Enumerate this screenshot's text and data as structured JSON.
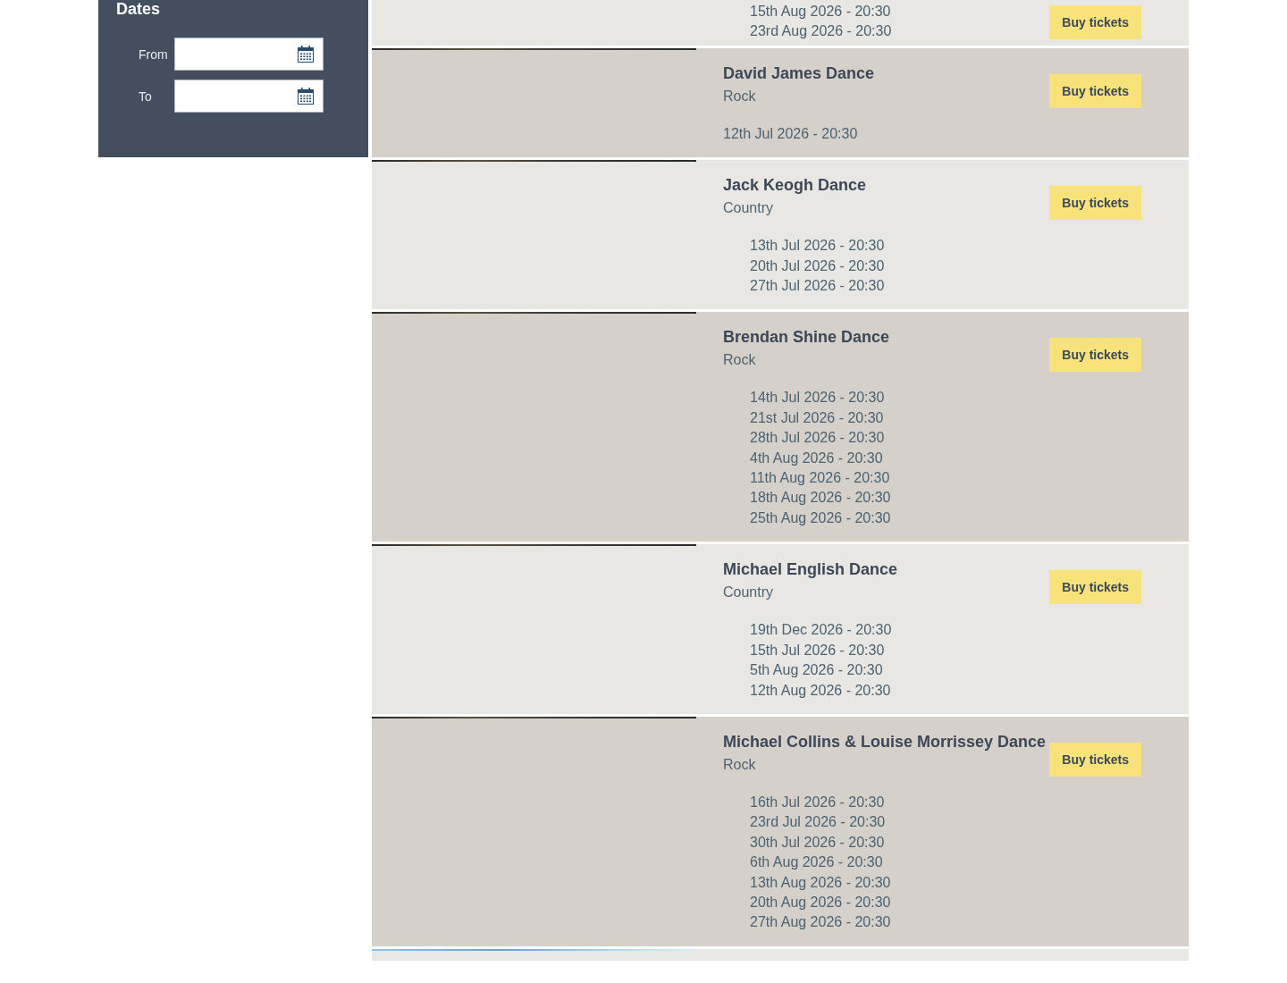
{
  "sidebar": {
    "title": "Dates",
    "fields": [
      {
        "label": "From"
      },
      {
        "label": "To"
      }
    ]
  },
  "events": [
    {
      "dates": [
        "15th Aug 2026 - 20:30",
        "23rd Aug 2026 - 20:30"
      ],
      "button": "Buy tickets"
    },
    {
      "title": "David James Dance",
      "genre": "Rock",
      "dates": [
        "12th Jul 2026 - 20:30"
      ],
      "button": "Buy tickets"
    },
    {
      "title": "Jack Keogh Dance",
      "genre": "Country",
      "dates": [
        "13th Jul 2026 - 20:30",
        "20th Jul 2026 - 20:30",
        "27th Jul 2026 - 20:30"
      ],
      "button": "Buy tickets"
    },
    {
      "title": "Brendan Shine Dance",
      "genre": "Rock",
      "dates": [
        "14th Jul 2026 - 20:30",
        "21st Jul 2026 - 20:30",
        "28th Jul 2026 - 20:30",
        "4th Aug 2026 - 20:30",
        "11th Aug 2026 - 20:30",
        "18th Aug 2026 - 20:30",
        "25th Aug 2026 - 20:30"
      ],
      "button": "Buy tickets"
    },
    {
      "title": "Michael English Dance",
      "genre": "Country",
      "dates": [
        "19th Dec 2026 - 20:30",
        "15th Jul 2026 - 20:30",
        "5th Aug 2026 - 20:30",
        "12th Aug 2026 - 20:30"
      ],
      "button": "Buy tickets"
    },
    {
      "title": "Michael Collins & Louise Morrissey Dance",
      "genre": "Rock",
      "dates": [
        "16th Jul 2026 - 20:30",
        "23rd Jul 2026 - 20:30",
        "30th Jul 2026 - 20:30",
        "6th Aug 2026 - 20:30",
        "13th Aug 2026 - 20:30",
        "20th Aug 2026 - 20:30",
        "27th Aug 2026 - 20:30"
      ],
      "button": "Buy tickets"
    }
  ]
}
